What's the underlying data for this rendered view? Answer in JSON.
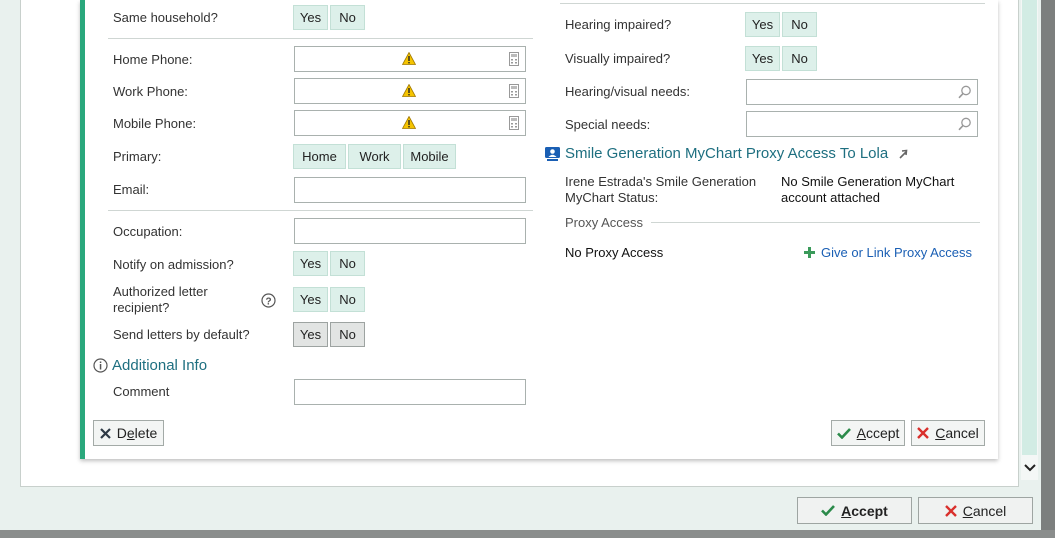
{
  "left": {
    "same_household": {
      "label": "Same household?",
      "yes": "Yes",
      "no": "No"
    },
    "home_phone": {
      "label": "Home Phone:"
    },
    "work_phone": {
      "label": "Work Phone:"
    },
    "mobile_phone": {
      "label": "Mobile Phone:"
    },
    "primary": {
      "label": "Primary:",
      "options": [
        "Home",
        "Work",
        "Mobile"
      ]
    },
    "email": {
      "label": "Email:"
    },
    "occupation": {
      "label": "Occupation:"
    },
    "notify_admission": {
      "label": "Notify on admission?",
      "yes": "Yes",
      "no": "No"
    },
    "authorized_letter": {
      "label_line1": "Authorized letter",
      "label_line2": "recipient?",
      "yes": "Yes",
      "no": "No"
    },
    "send_letters": {
      "label": "Send letters by default?",
      "yes": "Yes",
      "no": "No"
    },
    "additional_info": {
      "title": "Additional Info"
    },
    "comment": {
      "label": "Comment"
    }
  },
  "right": {
    "hearing_impaired": {
      "label": "Hearing impaired?",
      "yes": "Yes",
      "no": "No"
    },
    "visually_impaired": {
      "label": "Visually impaired?",
      "yes": "Yes",
      "no": "No"
    },
    "hearing_visual_needs": {
      "label": "Hearing/visual needs:"
    },
    "special_needs": {
      "label": "Special needs:"
    },
    "mychart": {
      "title": "Smile Generation MyChart Proxy Access To Lola",
      "status_label_line1": "Irene Estrada's Smile Generation",
      "status_label_line2": "MyChart Status:",
      "status_value_line1": "No Smile Generation MyChart",
      "status_value_line2": "account attached",
      "proxy_heading": "Proxy Access",
      "proxy_value": "No Proxy Access",
      "give_link": "Give or Link Proxy Access"
    }
  },
  "dialog_buttons": {
    "delete_prefix": "D",
    "delete_underlined": "e",
    "delete_suffix": "lete",
    "accept_underlined": "A",
    "accept_suffix": "ccept",
    "cancel_underlined": "C",
    "cancel_suffix": "ancel"
  },
  "footer_buttons": {
    "accept_underlined": "A",
    "accept_suffix": "ccept",
    "cancel_underlined": "C",
    "cancel_suffix": "ancel"
  },
  "colors": {
    "accent_green": "#2aa87c",
    "toggle_bg": "#ddf0ea",
    "link_blue": "#1a5fb4",
    "section_teal": "#1e6f80",
    "warning_yellow": "#f5c400",
    "cancel_red": "#d9302c"
  }
}
